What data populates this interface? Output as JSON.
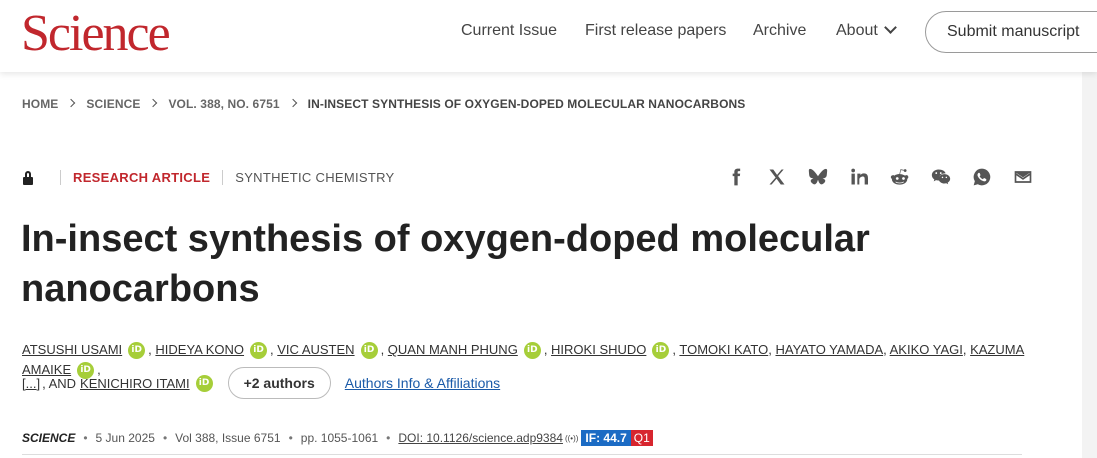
{
  "header": {
    "logo": "Science",
    "nav": [
      {
        "label": "Current Issue"
      },
      {
        "label": "First release papers"
      },
      {
        "label": "Archive"
      },
      {
        "label": "About"
      }
    ],
    "submit_label": "Submit manuscript"
  },
  "breadcrumb": [
    "HOME",
    "SCIENCE",
    "VOL. 388, NO. 6751",
    "IN-INSECT SYNTHESIS OF OXYGEN-DOPED MOLECULAR NANOCARBONS"
  ],
  "article": {
    "type": "RESEARCH ARTICLE",
    "subject": "SYNTHETIC CHEMISTRY",
    "title": "In-insect synthesis of oxygen-doped molecular nanocarbons",
    "authors": [
      {
        "name": "ATSUSHI USAMI",
        "orcid": true
      },
      {
        "name": "HIDEYA KONO",
        "orcid": true
      },
      {
        "name": "VIC AUSTEN",
        "orcid": true
      },
      {
        "name": "QUAN MANH PHUNG",
        "orcid": true
      },
      {
        "name": "HIROKI SHUDO",
        "orcid": true
      },
      {
        "name": "TOMOKI KATO",
        "orcid": false
      },
      {
        "name": "HAYATO YAMADA",
        "orcid": false
      },
      {
        "name": "AKIKO YAGI",
        "orcid": false
      },
      {
        "name": "KAZUMA AMAIKE",
        "orcid": true
      }
    ],
    "ellipsis": "[...]",
    "and_text": ", AND",
    "last_author": "KENICHIRO ITAMI",
    "more_authors_label": "+2 authors",
    "affiliations_label": "Authors Info & Affiliations",
    "orcid_label": "iD"
  },
  "citation": {
    "journal": "SCIENCE",
    "date": "5 Jun 2025",
    "volume": "Vol 388, Issue 6751",
    "pages": "pp. 1055-1061",
    "doi": "DOI: 10.1126/science.adp9384",
    "impact_factor": "IF: 44.7",
    "quartile": "Q1"
  },
  "share_icons": [
    "facebook-icon",
    "x-icon",
    "bluesky-icon",
    "linkedin-icon",
    "reddit-icon",
    "wechat-icon",
    "whatsapp-icon",
    "email-icon"
  ],
  "colors": {
    "brand_red": "#c1272d",
    "link_blue": "#1a5aa8",
    "orcid_green": "#a6ce39",
    "if_blue": "#1b6bc4",
    "q1_red": "#d7252e"
  }
}
